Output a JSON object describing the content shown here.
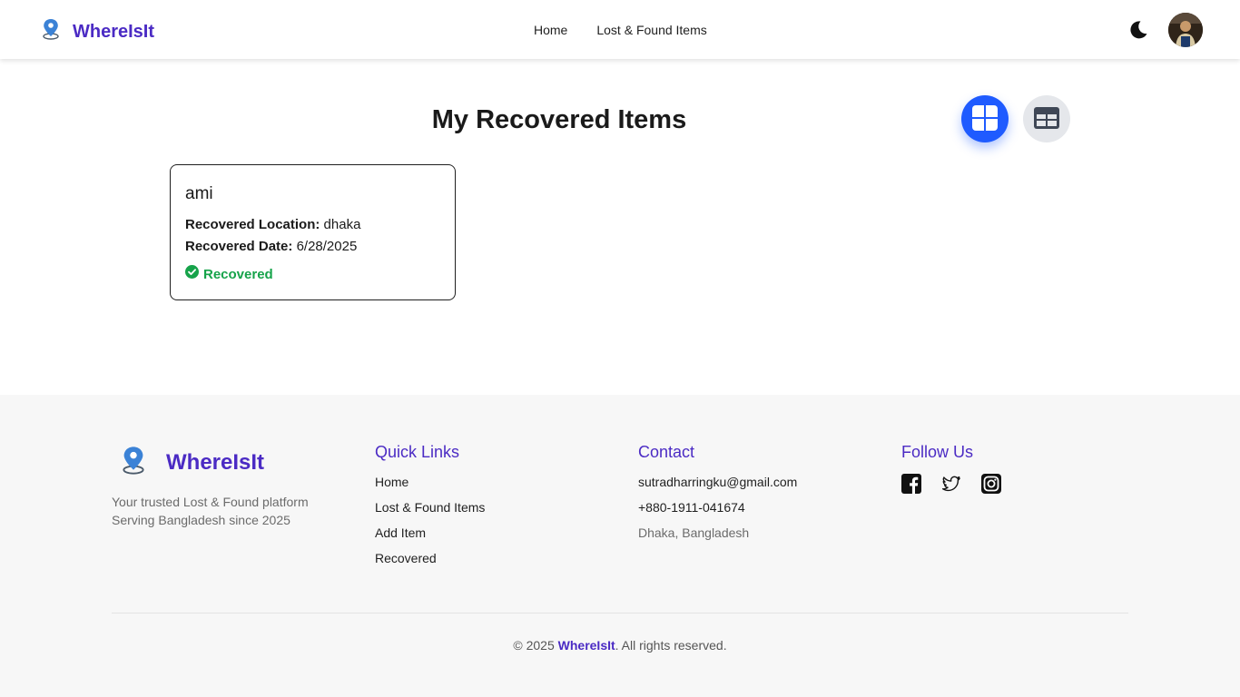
{
  "navbar": {
    "brand": "WhereIsIt",
    "links": [
      {
        "label": "Home"
      },
      {
        "label": "Lost & Found Items"
      }
    ],
    "icons": {
      "logo": "map-pin-icon",
      "theme": "moon-icon",
      "avatar": "user-avatar"
    }
  },
  "main": {
    "title": "My Recovered Items",
    "views": {
      "grid": "grid-view-icon",
      "table": "table-view-icon",
      "active": "grid"
    },
    "items": [
      {
        "title": "ami",
        "location_label": "Recovered Location:",
        "location": "dhaka",
        "date_label": "Recovered Date:",
        "date": "6/28/2025",
        "status": "Recovered"
      }
    ]
  },
  "footer": {
    "brand": "WhereIsIt",
    "tagline_1": "Your trusted Lost & Found platform",
    "tagline_2": "Serving Bangladesh since 2025",
    "quick_links": {
      "heading": "Quick Links",
      "items": [
        "Home",
        "Lost & Found Items",
        "Add Item",
        "Recovered"
      ]
    },
    "contact": {
      "heading": "Contact",
      "email": "sutradharringku@gmail.com",
      "phone": "+880-1911-041674",
      "address": "Dhaka, Bangladesh"
    },
    "follow": {
      "heading": "Follow Us",
      "icons": [
        "facebook-icon",
        "twitter-icon",
        "instagram-icon"
      ]
    },
    "copyright_prefix": "© 2025 ",
    "copyright_brand": "WhereIsIt",
    "copyright_suffix": ". All rights reserved."
  },
  "colors": {
    "brand": "#4b2bc4",
    "accent": "#1f5bff",
    "success": "#16a34a",
    "footer_bg": "#f7f7f7"
  }
}
